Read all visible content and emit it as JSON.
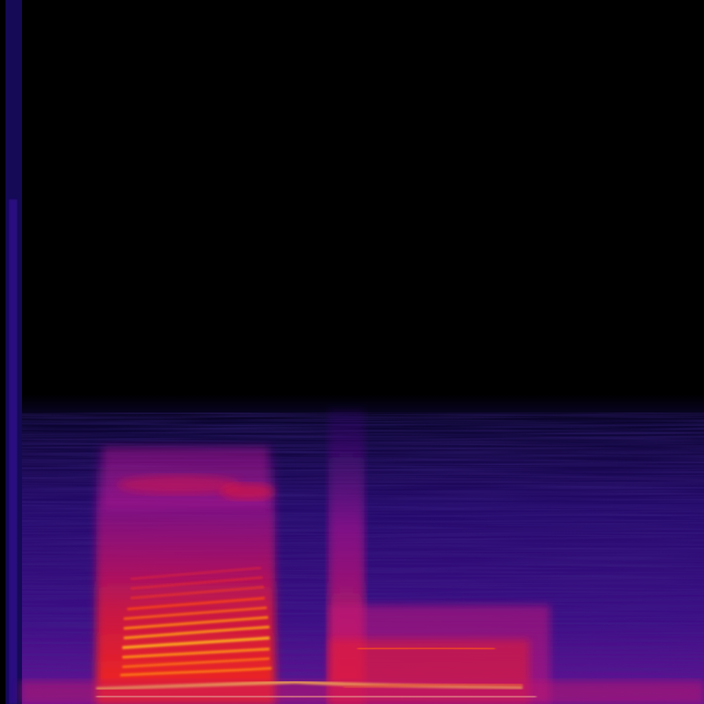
{
  "image": {
    "kind": "spectrogram",
    "colormap": [
      "#000000",
      "#0b0530",
      "#2a0a6e",
      "#5b0f8c",
      "#8c1a9a",
      "#c8108a",
      "#ef1d2b",
      "#ff5a00",
      "#ffc21a",
      "#fff6b0"
    ],
    "background": "#000000"
  }
}
